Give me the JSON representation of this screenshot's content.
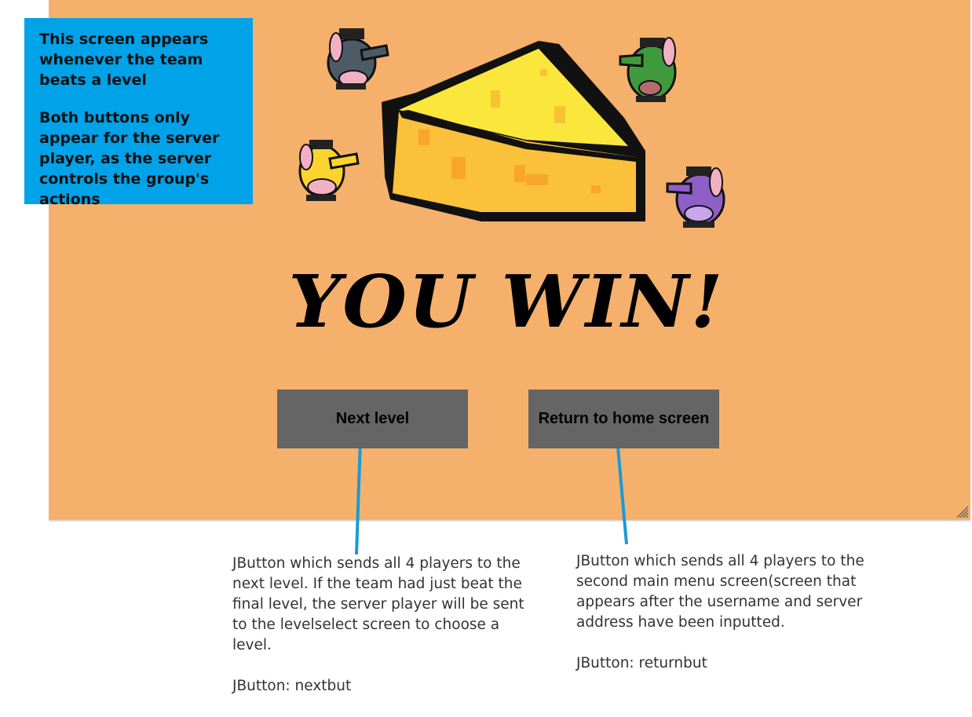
{
  "annotation": {
    "lines": [
      "This screen appears whenever the team beats a level",
      "Both buttons only appear for the server player, as the server controls the group's actions"
    ]
  },
  "game": {
    "title": "YOU WIN!",
    "buttons": {
      "next": "Next level",
      "return": "Return to home screen"
    }
  },
  "notes": {
    "next": {
      "description": "JButton which sends all 4 players to the next level. If the team had just beat the final level, the server player will be sent to the levelselect screen to choose a level.",
      "component": "JButton: nextbut"
    },
    "return": {
      "description": "JButton which sends all 4 players to the second main menu screen(screen that appears after the username and server address have been inputted.",
      "component": "JButton: returnbut"
    }
  },
  "colors": {
    "background": "#f5b06b",
    "annotation_box": "#00a2e8",
    "button": "#656565",
    "connector": "#1a9ad6"
  },
  "characters": [
    "grey-rat",
    "green-rat",
    "yellow-rat",
    "purple-rat"
  ],
  "icons": [
    "cheese-icon",
    "resize-grip-icon"
  ]
}
